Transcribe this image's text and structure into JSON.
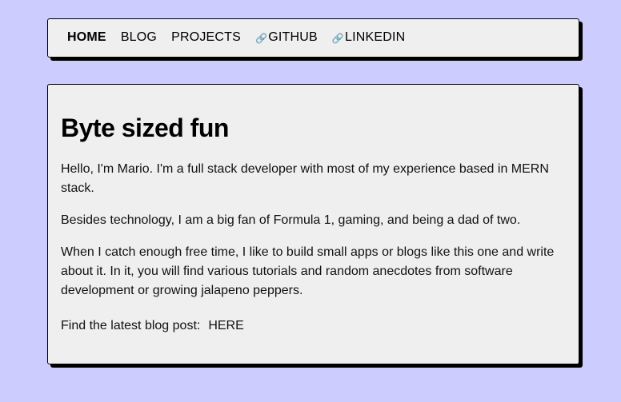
{
  "nav": {
    "items": [
      {
        "label": "HOME",
        "active": true,
        "icon": null
      },
      {
        "label": "BLOG",
        "active": false,
        "icon": null
      },
      {
        "label": "PROJECTS",
        "active": false,
        "icon": null
      },
      {
        "label": "GITHUB",
        "active": false,
        "icon": "link-icon"
      },
      {
        "label": "LINKEDIN",
        "active": false,
        "icon": "link-icon"
      }
    ],
    "link_glyph": "🔗"
  },
  "main": {
    "title": "Byte sized fun",
    "paragraphs": [
      "Hello, I'm Mario. I'm a full stack developer with most of my experience based in MERN stack.",
      "Besides technology, I am a big fan of Formula 1, gaming, and being a dad of two.",
      "When I catch enough free time, I like to build small apps or blogs like this one and write about it. In it, you will find various tutorials and random anecdotes from software development or growing jalapeno peppers."
    ],
    "cta_text": "Find the latest blog post:",
    "cta_link": "HERE"
  },
  "colors": {
    "background": "#ccccff",
    "card": "#efefef",
    "border": "#000000"
  }
}
